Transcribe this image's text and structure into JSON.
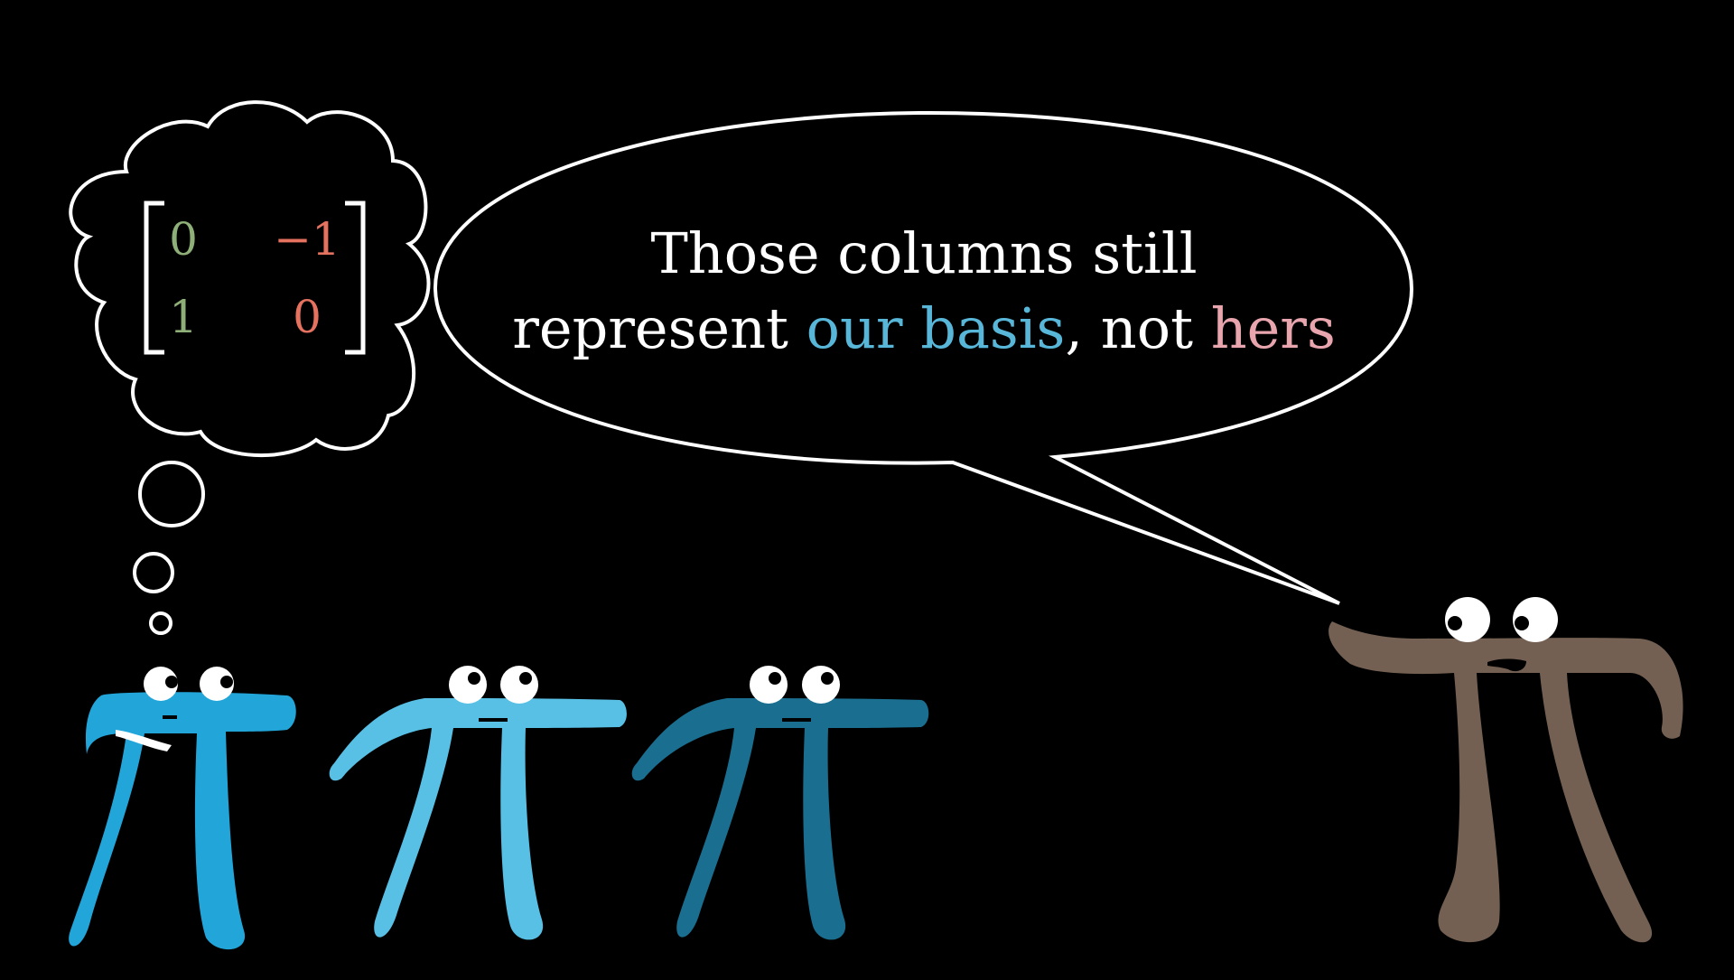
{
  "colors": {
    "background": "#000000",
    "outline": "#ffffff",
    "speech_text": "#ffffff",
    "our_basis": "#58b7d9",
    "hers": "#e8a5ad",
    "matrix_first_column": "#8eb078",
    "matrix_second_column": "#e5715f",
    "pi_1": "#22a6da",
    "pi_2": "#58bfe5",
    "pi_3": "#1a6f90",
    "pi_4": "#736052",
    "eye": "#ffffff",
    "pupil": "#000000"
  },
  "thought_bubble": {
    "matrix": {
      "row1": [
        "0",
        "−1"
      ],
      "row2": [
        "1",
        "0"
      ]
    }
  },
  "speech_bubble": {
    "line1": "Those columns still",
    "line2_part1": "represent ",
    "line2_highlight1": "our basis",
    "line2_part2": ", not ",
    "line2_highlight2": "hers"
  },
  "characters": [
    {
      "name": "pi-creature-1",
      "color_key": "pi_1",
      "expression": "looking right"
    },
    {
      "name": "pi-creature-2",
      "color_key": "pi_2",
      "expression": "looking up"
    },
    {
      "name": "pi-creature-3",
      "color_key": "pi_3",
      "expression": "looking up"
    },
    {
      "name": "pi-creature-speaker",
      "color_key": "pi_4",
      "expression": "speaking"
    }
  ]
}
